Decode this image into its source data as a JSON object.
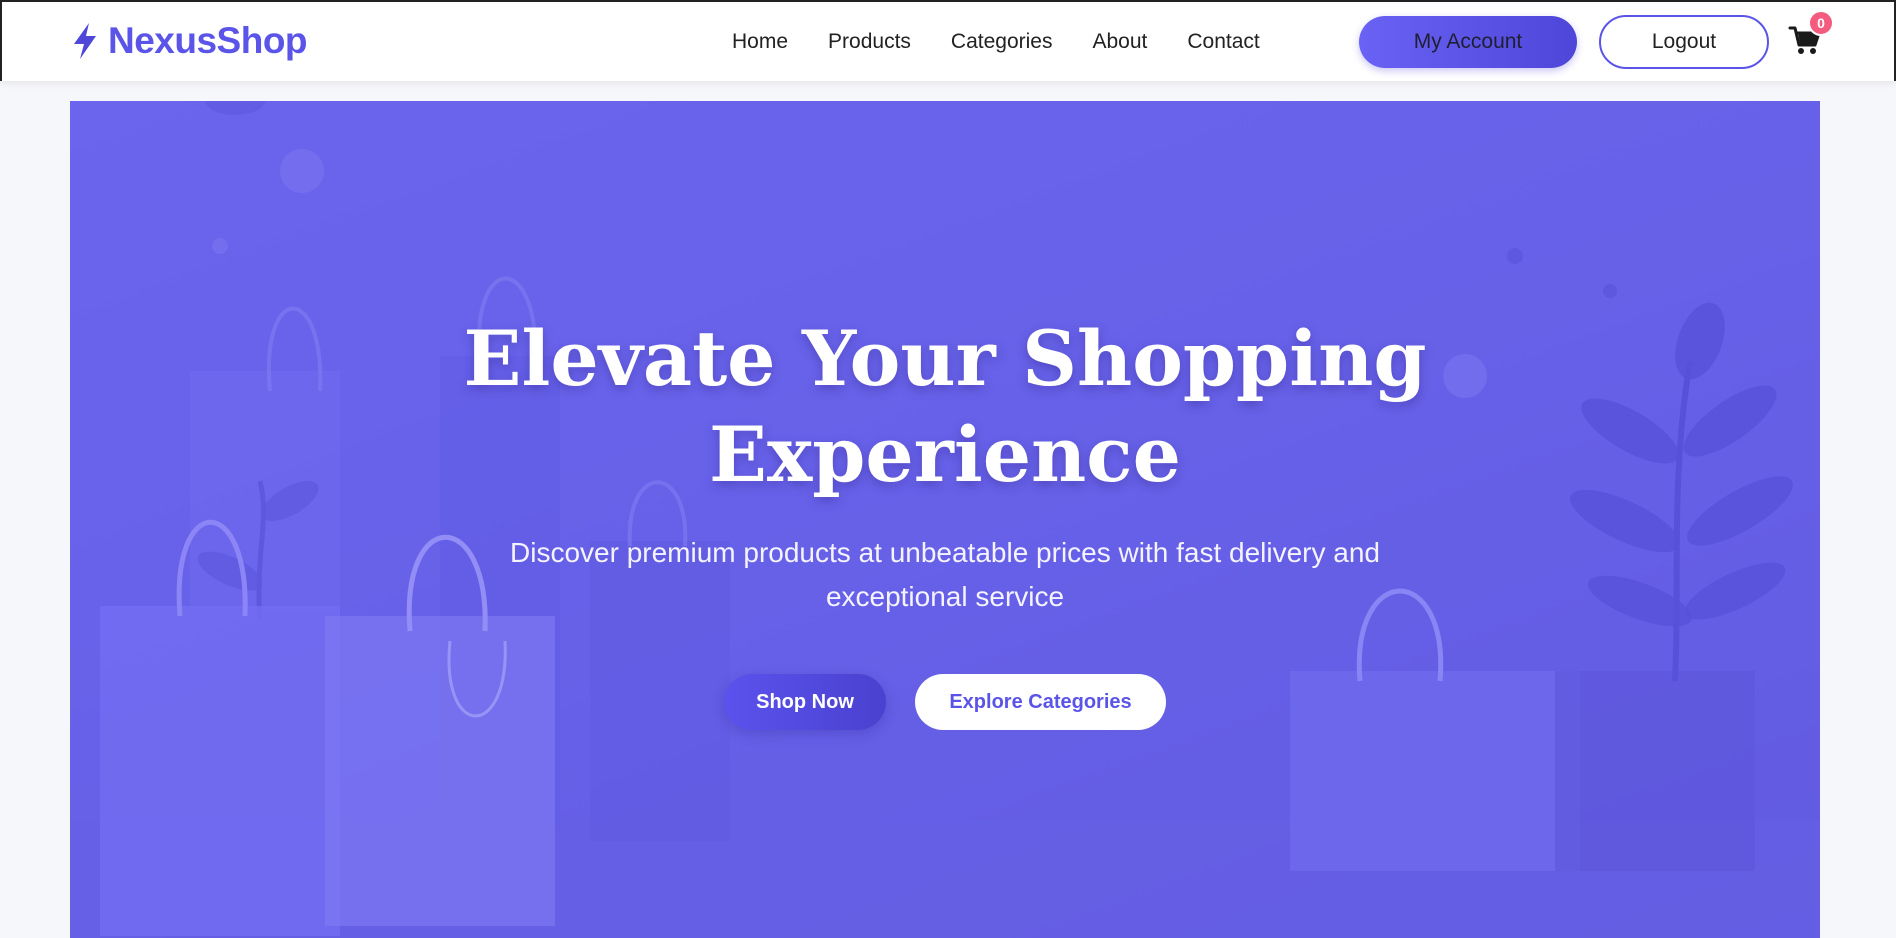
{
  "brand": {
    "name": "NexusShop",
    "accent": "#5b54e8"
  },
  "nav": {
    "links": [
      {
        "label": "Home"
      },
      {
        "label": "Products"
      },
      {
        "label": "Categories"
      },
      {
        "label": "About"
      },
      {
        "label": "Contact"
      }
    ],
    "account_label": "My Account",
    "logout_label": "Logout",
    "cart_count": "0"
  },
  "hero": {
    "title": "Elevate Your Shopping Experience",
    "subtitle": "Discover premium products at unbeatable prices with fast delivery and exceptional service",
    "primary_cta": "Shop Now",
    "secondary_cta": "Explore Categories",
    "background_color": "#6862e8"
  },
  "icons": {
    "logo": "lightning-bolt-icon",
    "cart": "shopping-cart-icon"
  }
}
